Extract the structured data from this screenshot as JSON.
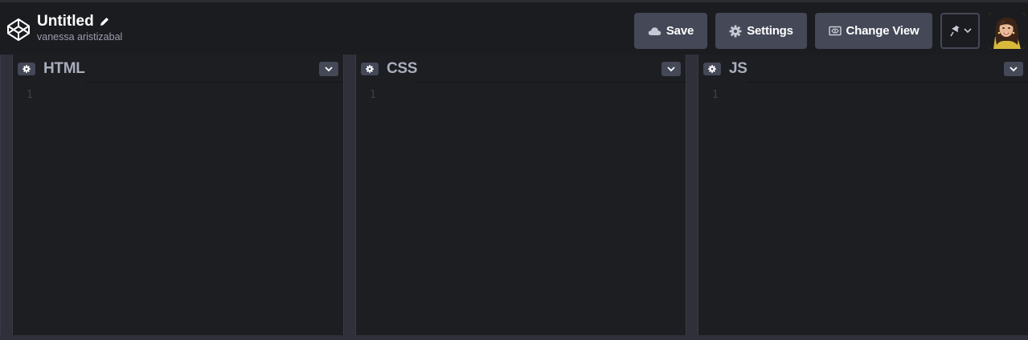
{
  "header": {
    "pen_title": "Untitled",
    "author": "vanessa aristizabal",
    "buttons": {
      "save": "Save",
      "settings": "Settings",
      "change_view": "Change View"
    },
    "icons": {
      "logo": "codepen-logo-icon",
      "pencil": "pencil-icon",
      "cloud": "cloud-icon",
      "gear": "gear-icon",
      "view": "layout-view-icon",
      "pin": "pin-icon",
      "chevron": "chevron-down-icon"
    }
  },
  "editors": [
    {
      "title": "HTML",
      "line_number": "1"
    },
    {
      "title": "CSS",
      "line_number": "1"
    },
    {
      "title": "JS",
      "line_number": "1"
    }
  ],
  "colors": {
    "topbar_bg": "#1b1c20",
    "button_bg": "#444857",
    "editor_bg": "#1d1e22",
    "resizer_bg": "#2f3039",
    "editor_title": "#aaaebc"
  }
}
